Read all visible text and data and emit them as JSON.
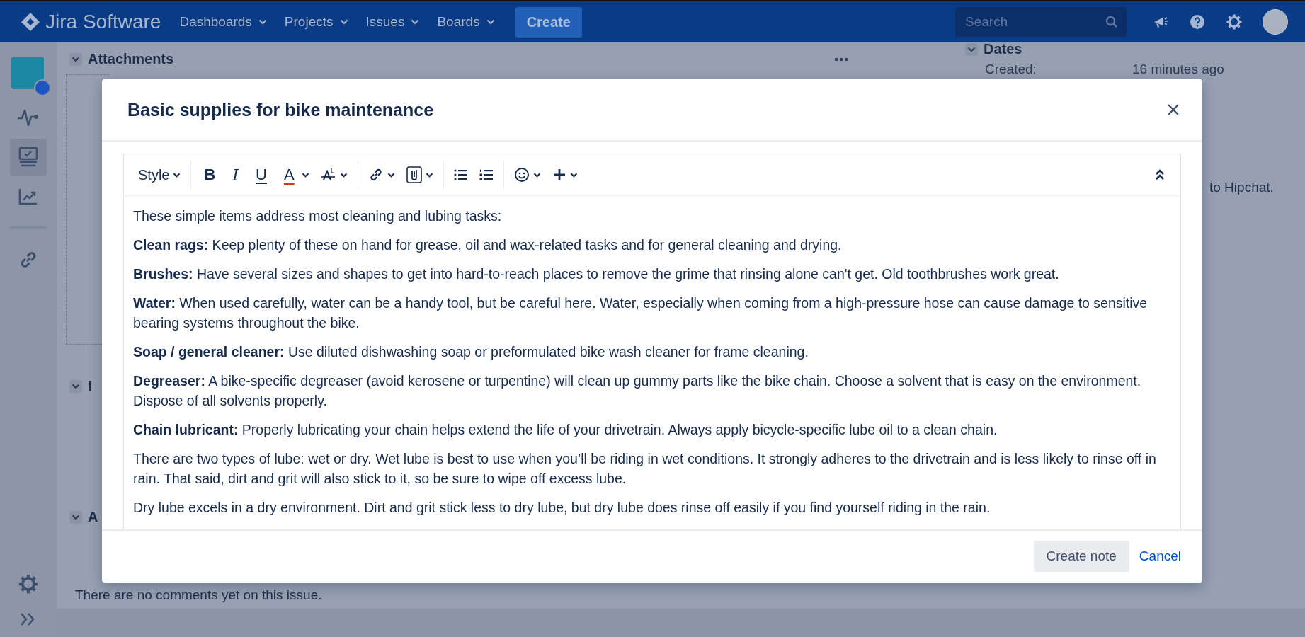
{
  "top_nav": {
    "product": "Jira Software",
    "menus": [
      {
        "label": "Dashboards"
      },
      {
        "label": "Projects"
      },
      {
        "label": "Issues"
      },
      {
        "label": "Boards"
      }
    ],
    "create_button": "Create",
    "search": {
      "placeholder": "Search"
    }
  },
  "sidebar": {
    "items": [
      {
        "selected": false
      },
      {
        "selected": true
      },
      {
        "selected": false
      },
      {
        "selected": false
      }
    ]
  },
  "background": {
    "attachments": {
      "title": "Attachments"
    },
    "section_2": {
      "title": "I"
    },
    "section_3": {
      "title": "A"
    },
    "comments_note": "There are no comments yet on this issue.",
    "dates": {
      "title": "Dates",
      "created_label": "Created:",
      "created_value": "16 minutes ago"
    },
    "side_note": "to Hipchat."
  },
  "modal": {
    "title": "Basic supplies for bike maintenance",
    "editor": {
      "style_label": "Style",
      "format_glyphs": [
        "B",
        "I",
        "U",
        "A"
      ],
      "paragraphs": [
        "These simple items address most cleaning and lubing tasks:",
        "**Clean rags:** Keep plenty of these on hand for grease, oil and wax-related tasks and for general cleaning and drying.",
        "**Brushes:** Have several sizes and shapes to get into hard-to-reach places to remove the grime that rinsing alone can't get. Old toothbrushes work great.",
        "**Water:** When used carefully, water can be a handy tool, but be careful here. Water, especially when coming from a high-pressure hose can cause damage to sensitive bearing systems throughout the bike.",
        "**Soap / general cleaner:** Use diluted dishwashing soap or preformulated bike wash cleaner for frame cleaning.",
        "**Degreaser:** A bike-specific degreaser (avoid kerosene or turpentine) will clean up gummy parts like the bike chain. Choose a solvent that is easy on the environment. Dispose of all solvents properly.",
        "**Chain lubricant:**  Properly lubricating your chain helps extend the life of your drivetrain. Always apply bicycle-specific lube oil to a clean chain.",
        "There are two types of lube: wet or dry. Wet lube is best to use when you’ll be riding in wet conditions. It strongly adheres to the drivetrain and is less likely to rinse off in rain. That said, dirt and grit will also stick to it, so be sure to wipe off excess lube.",
        "Dry lube excels in a dry environment. Dirt and grit stick less to dry lube, but dry lube does rinse off easily if you find yourself riding in the rain."
      ]
    },
    "buttons": {
      "primary": "Create note",
      "cancel": "Cancel"
    }
  }
}
